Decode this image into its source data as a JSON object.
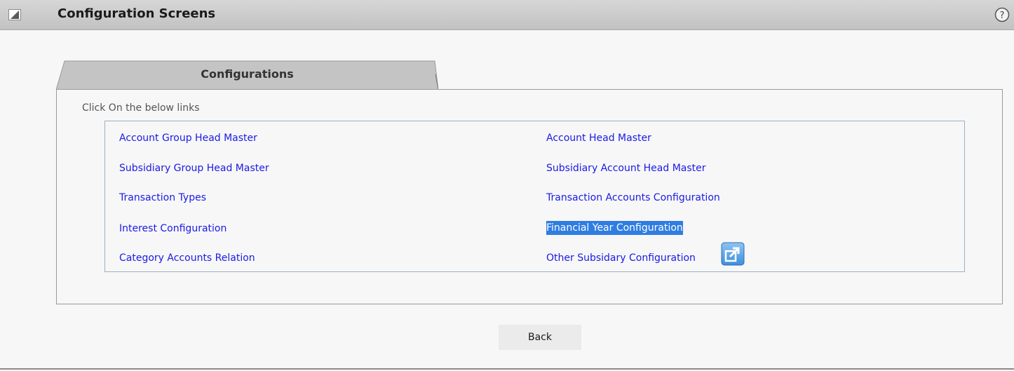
{
  "header": {
    "title": "Configuration Screens",
    "collapse_icon": "collapse-icon",
    "help_icon": "help-icon"
  },
  "tab": {
    "label": "Configurations"
  },
  "panel": {
    "instructions": "Click On the below links",
    "links": {
      "account_group_head_master": "Account Group Head Master",
      "account_head_master": "Account Head Master",
      "subsidiary_group_head_master": "Subsidiary Group Head Master",
      "subsidiary_account_head_master": "Subsidiary Account Head Master",
      "transaction_types": "Transaction Types",
      "transaction_accounts_configuration": "Transaction Accounts Configuration",
      "interest_configuration": "Interest Configuration",
      "financial_year_configuration": "Financial Year Configuration",
      "category_accounts_relation": "Category Accounts Relation",
      "other_subsidary_configuration": "Other Subsidary Configuration"
    },
    "selected_link": "Financial Year Configuration",
    "popout_icon": "external-link-icon"
  },
  "footer": {
    "back_label": "Back"
  },
  "colors": {
    "link": "#1a1ae6",
    "selection": "#2f7de1",
    "titlebar": "#c8c8c8",
    "tab": "#c4c4c4"
  }
}
